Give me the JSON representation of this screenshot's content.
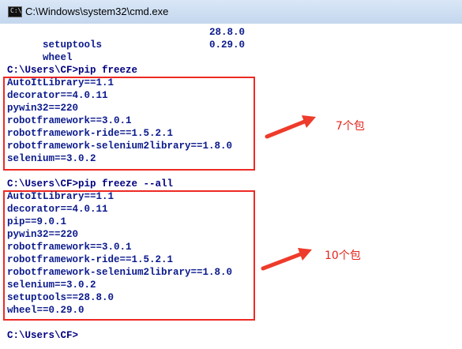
{
  "window": {
    "title": "C:\\Windows\\system32\\cmd.exe",
    "icon": "C:\\"
  },
  "top_rows": [
    {
      "name": "setuptools",
      "version": "28.8.0"
    },
    {
      "name": "wheel",
      "version": "0.29.0"
    }
  ],
  "cmd1": {
    "prompt": "C:\\Users\\CF>pip freeze",
    "output": [
      "AutoItLibrary==1.1",
      "decorator==4.0.11",
      "pywin32==220",
      "robotframework==3.0.1",
      "robotframework-ride==1.5.2.1",
      "robotframework-selenium2library==1.8.0",
      "selenium==3.0.2"
    ],
    "note": "7个包"
  },
  "cmd2": {
    "prompt": "C:\\Users\\CF>pip freeze --all",
    "output": [
      "AutoItLibrary==1.1",
      "decorator==4.0.11",
      "pip==9.0.1",
      "pywin32==220",
      "robotframework==3.0.1",
      "robotframework-ride==1.5.2.1",
      "robotframework-selenium2library==1.8.0",
      "selenium==3.0.2",
      "setuptools==28.8.0",
      "wheel==0.29.0"
    ],
    "note": "10个包"
  },
  "final_prompt": "C:\\Users\\CF>",
  "colors": {
    "console_text": "#0b1a8c",
    "annotation": "#e3241b",
    "titlebar": "#c4d7ee"
  }
}
